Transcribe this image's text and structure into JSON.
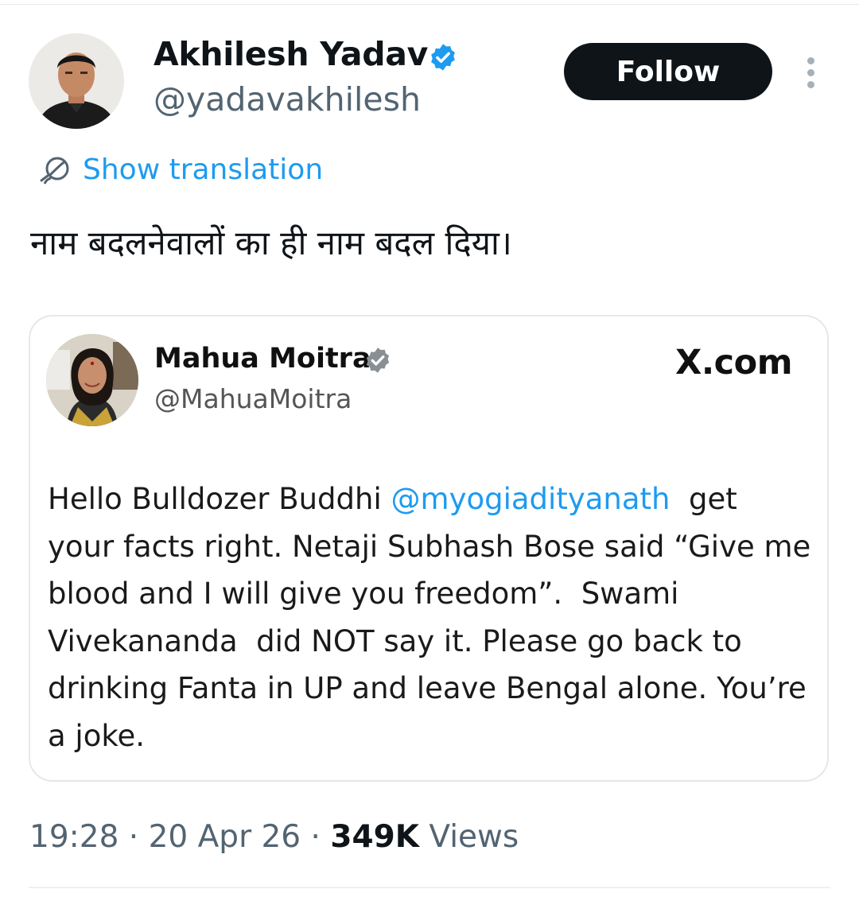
{
  "author": {
    "display_name": "Akhilesh Yadav",
    "handle": "@yadavakhilesh",
    "verified_icon": "verified-badge-icon",
    "verified_color": "#1d9bf0"
  },
  "actions": {
    "follow_label": "Follow",
    "more_icon": "more-vertical-icon"
  },
  "translation": {
    "icon": "translate-globe-icon",
    "label": "Show translation",
    "color": "#1d9bf0"
  },
  "tweet": {
    "text": "नाम बदलनेवालों का ही नाम बदल दिया।"
  },
  "quoted_post": {
    "display_name": "Mahua Moitra",
    "handle": "@MahuaMoitra",
    "verified_icon": "verified-badge-icon",
    "verified_color": "#8a8f94",
    "source": "X.com",
    "text_before_mention": "Hello Bulldozer Buddhi ",
    "mention": "@myogiadityanath",
    "text_after_mention": "  get your facts right. Netaji Subhash Bose said “Give me blood and I will give you freedom”.  Swami Vivekananda  did NOT say it. Please go back to drinking Fanta in UP and leave Bengal alone. You’re a joke."
  },
  "meta": {
    "time": "19:28",
    "separator": " · ",
    "date": "20 Apr 26",
    "views_count": "349K",
    "views_label": " Views"
  }
}
